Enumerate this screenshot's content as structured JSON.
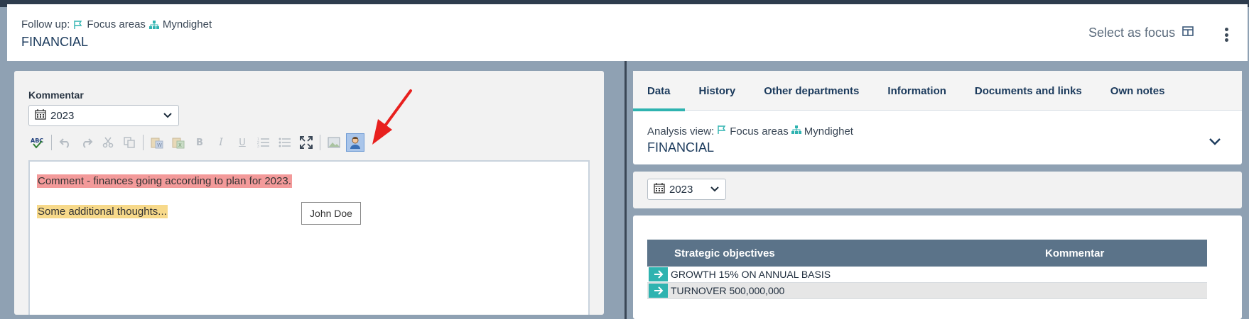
{
  "header": {
    "followup_label": "Follow up:",
    "focus_areas": "Focus areas",
    "org": "Myndighet",
    "title": "FINANCIAL",
    "select_focus": "Select as focus"
  },
  "left_panel": {
    "label": "Kommentar",
    "year": "2023",
    "toolbar_icons": [
      "spellcheck-icon",
      "undo-icon",
      "redo-icon",
      "cut-icon",
      "copy-icon",
      "paste-word-icon",
      "paste-excel-icon",
      "bold-icon",
      "italic-icon",
      "underline-icon",
      "numbered-list-icon",
      "bullet-list-icon",
      "fullscreen-icon",
      "image-icon",
      "user-mention-icon"
    ],
    "editor": {
      "line1": "Comment - finances going according to plan for 2023.",
      "line2": "Some additional thoughts...",
      "tooltip": "John Doe"
    },
    "colors": {
      "highlight_red": "#f39a9a",
      "highlight_yellow": "#f7d98a",
      "annotation_arrow": "#e8201e"
    }
  },
  "right_panel": {
    "tabs": [
      {
        "label": "Data",
        "active": true
      },
      {
        "label": "History",
        "active": false
      },
      {
        "label": "Other departments",
        "active": false
      },
      {
        "label": "Information",
        "active": false
      },
      {
        "label": "Documents and links",
        "active": false
      },
      {
        "label": "Own notes",
        "active": false
      }
    ],
    "analysis_label": "Analysis view:",
    "focus_areas": "Focus areas",
    "org": "Myndighet",
    "title": "FINANCIAL",
    "year": "2023",
    "table": {
      "headers": [
        "Strategic objectives",
        "Kommentar"
      ],
      "rows": [
        {
          "objective": "GROWTH 15% ON ANNUAL BASIS",
          "comment": ""
        },
        {
          "objective": "TURNOVER 500,000,000",
          "comment": ""
        }
      ]
    },
    "colors": {
      "accent": "#2fb3b0",
      "table_header": "#5b7389"
    }
  }
}
